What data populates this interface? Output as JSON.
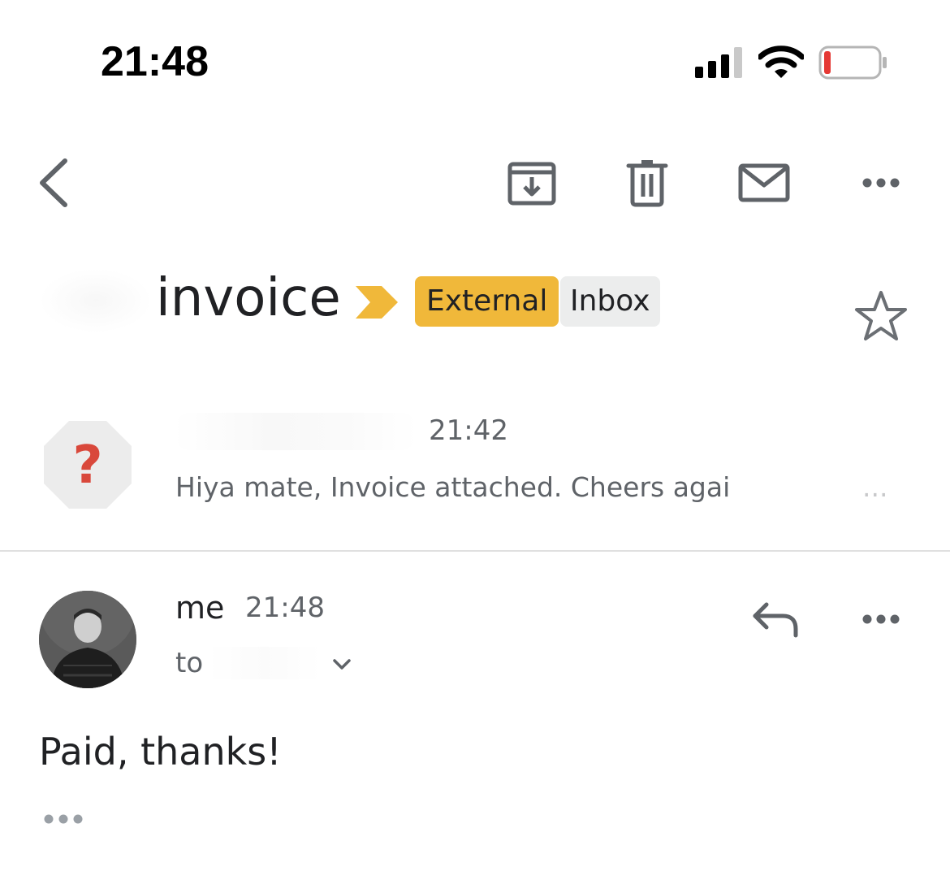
{
  "status_bar": {
    "time": "21:48",
    "battery_level": 0.1
  },
  "toolbar": {
    "icons": [
      "back-arrow-icon",
      "archive-icon",
      "trash-icon",
      "mail-icon",
      "more-horizontal-icon"
    ]
  },
  "thread": {
    "subject": "invoice",
    "labels": [
      {
        "text": "External",
        "color": "#f0b83a"
      },
      {
        "text": "Inbox",
        "color": "#eceded"
      }
    ],
    "starred": false
  },
  "messages": [
    {
      "time": "21:42",
      "snippet": "Hiya mate, Invoice attached. Cheers agai",
      "snippet_tail": "...",
      "avatar_glyph": "?"
    },
    {
      "from": "me",
      "time": "21:48",
      "to_label": "to",
      "body": "Paid, thanks!"
    }
  ],
  "colors": {
    "accent_label": "#f0b83a",
    "unknown_sender_question": "#d9483b",
    "secondary_text": "#5f6368",
    "icon_gray": "#5f6368"
  }
}
